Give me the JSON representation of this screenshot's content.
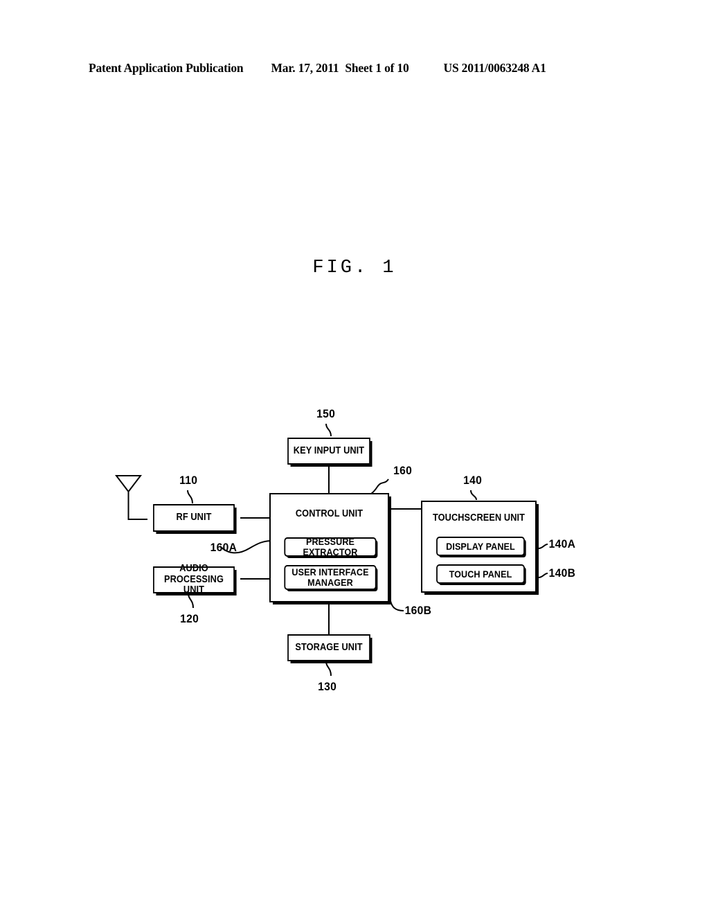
{
  "header": {
    "publication": "Patent Application Publication",
    "date": "Mar. 17, 2011",
    "sheet": "Sheet 1 of 10",
    "number": "US 2011/0063248 A1"
  },
  "figure": {
    "title": "FIG. 1"
  },
  "diagram": {
    "blocks": {
      "key_input_unit": "KEY INPUT UNIT",
      "rf_unit": "RF UNIT",
      "audio_processing_unit": "AUDIO PROCESSING\nUNIT",
      "storage_unit": "STORAGE UNIT",
      "control_unit": "CONTROL UNIT",
      "pressure_extractor": "PRESSURE EXTRACTOR",
      "user_interface_manager": "USER INTERFACE\nMANAGER",
      "touchscreen_unit": "TOUCHSCREEN UNIT",
      "display_panel": "DISPLAY PANEL",
      "touch_panel": "TOUCH PANEL"
    },
    "reference_numerals": {
      "rf_unit": "110",
      "audio_processing_unit": "120",
      "storage_unit": "130",
      "touchscreen_unit": "140",
      "display_panel": "140A",
      "touch_panel": "140B",
      "key_input_unit": "150",
      "control_unit": "160",
      "pressure_extractor": "160A",
      "user_interface_manager": "160B"
    },
    "icons": {
      "antenna": "antenna-icon"
    }
  }
}
